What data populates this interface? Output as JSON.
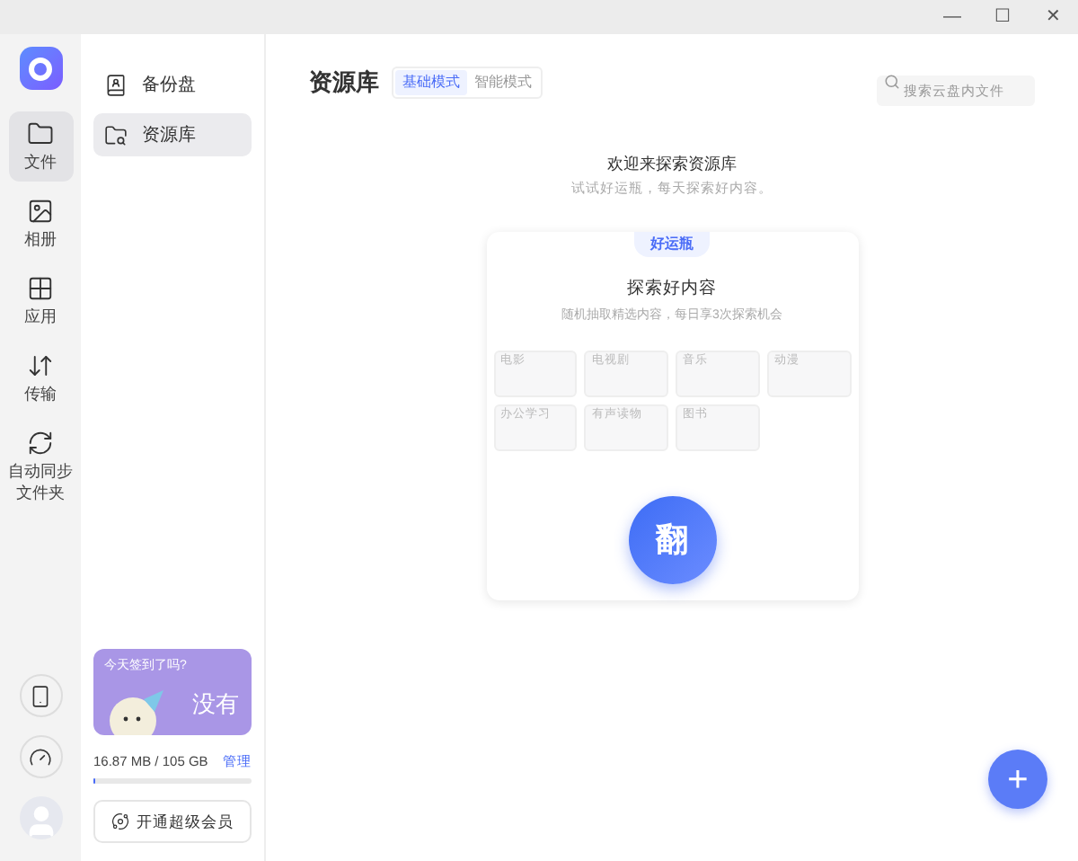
{
  "window_controls": [
    "—",
    "☐",
    "✕"
  ],
  "rail": {
    "items": [
      {
        "kind": "folder",
        "label": "文件",
        "selected": true
      },
      {
        "kind": "photo",
        "label": "相册",
        "selected": false
      },
      {
        "kind": "apps",
        "label": "应用",
        "selected": false
      },
      {
        "kind": "transfer",
        "label": "传输",
        "selected": false
      },
      {
        "kind": "sync",
        "label": "自动同步文件夹",
        "selected": false
      }
    ],
    "bottom": [
      {
        "kind": "phone"
      },
      {
        "kind": "gauge"
      },
      {
        "kind": "avatar"
      }
    ]
  },
  "sidebar": {
    "items": [
      {
        "kind": "backup",
        "label": "备份盘",
        "selected": false
      },
      {
        "kind": "library",
        "label": "资源库",
        "selected": true
      }
    ],
    "promo": {
      "question": "今天签到了吗?",
      "answer": "没有"
    },
    "storage": {
      "usage": "16.87 MB / 105 GB",
      "manage": "管理",
      "level": 0.01
    },
    "vip_button": "开通超级会员"
  },
  "header": {
    "title": "资源库",
    "modes": [
      {
        "label": "基础模式",
        "selected": true
      },
      {
        "label": "智能模式",
        "selected": false
      }
    ],
    "search": {
      "placeholder": "搜索云盘内文件"
    }
  },
  "welcome": {
    "title": "欢迎来探索资源库",
    "subtitle": "试试好运瓶，每天探索好内容。"
  },
  "card": {
    "badge": "好运瓶",
    "title": "探索好内容",
    "subtitle": "随机抽取精选内容，每日享3次探索机会",
    "tiles": [
      "电影",
      "电视剧",
      "音乐",
      "动漫",
      "办公学习",
      "有声读物",
      "图书"
    ],
    "flip": "翻"
  },
  "fab": "+"
}
